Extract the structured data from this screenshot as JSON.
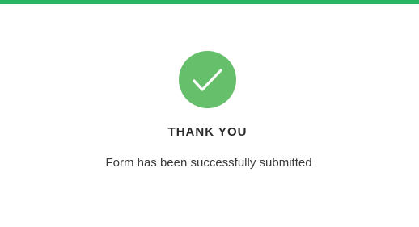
{
  "confirmation": {
    "icon": "checkmark-circle-icon",
    "title": "THANK YOU",
    "message": "Form has been successfully submitted"
  },
  "colors": {
    "top_bar": "#27b463",
    "icon_circle": "#66bf6a",
    "icon_check": "#ffffff",
    "title_text": "#2b2b2b",
    "message_text": "#3a3a3a"
  }
}
